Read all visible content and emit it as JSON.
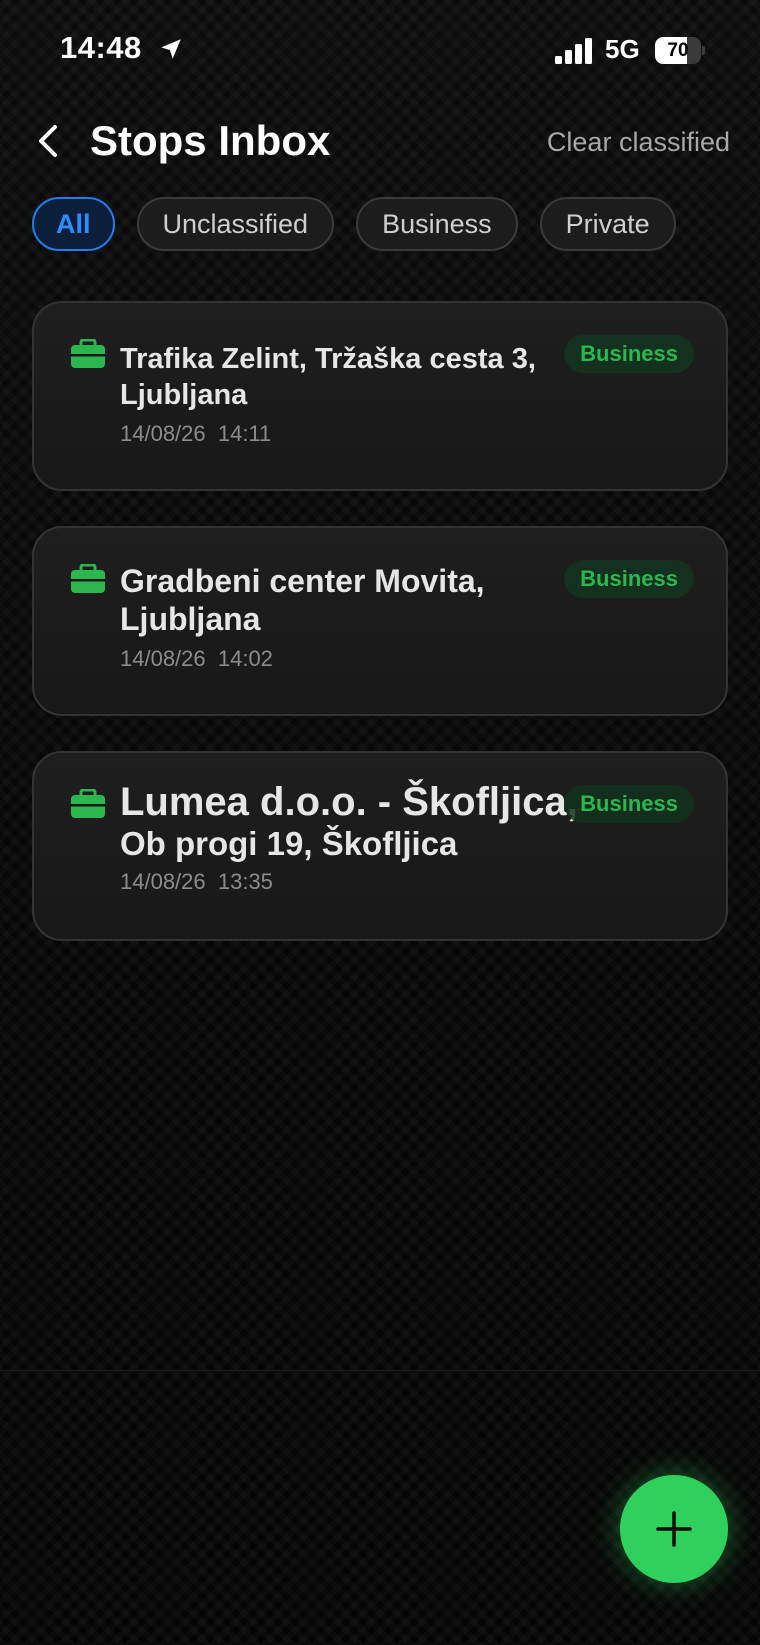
{
  "status_bar": {
    "time": "14:48",
    "network": "5G",
    "battery_level": "70",
    "battery_fraction": 0.7
  },
  "header": {
    "title": "Stops Inbox",
    "clear_label": "Clear classified"
  },
  "filters": [
    {
      "label": "All",
      "active": true
    },
    {
      "label": "Unclassified",
      "active": false
    },
    {
      "label": "Business",
      "active": false
    },
    {
      "label": "Private",
      "active": false
    }
  ],
  "stops": [
    {
      "title": "Trafika Zelint, Tržaška cesta 3, Ljubljana",
      "date": "14/08/26  14:11",
      "badge": "Business",
      "icon": "briefcase-icon"
    },
    {
      "title": "Gradbeni center Movita, Ljubljana",
      "date": "14/08/26  14:02",
      "badge": "Business",
      "icon": "briefcase-icon"
    },
    {
      "title_line1": "Lumea d.o.o. - Škofljica,",
      "title_line2": "Ob progi 19, Škofljica",
      "date": "14/08/26  13:35",
      "badge": "Business",
      "icon": "briefcase-icon"
    }
  ],
  "colors": {
    "accent_blue": "#2f8cff",
    "business_green": "#2bb64e",
    "fab_green": "#2fd05c"
  },
  "fab": {
    "icon": "plus-icon"
  }
}
